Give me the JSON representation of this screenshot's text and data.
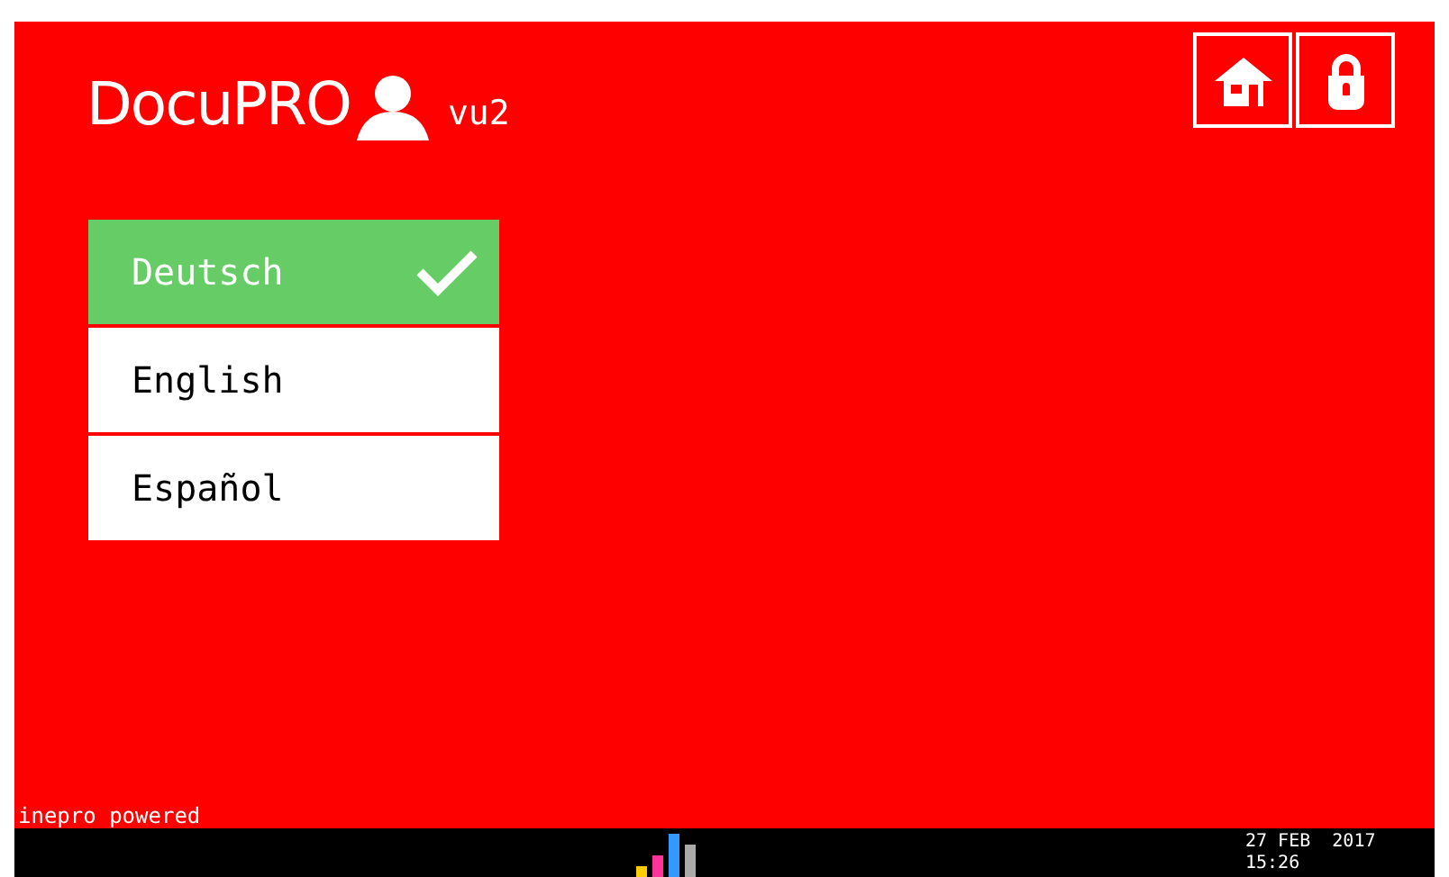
{
  "header": {
    "brand": "DocuPRO",
    "user": "vu2"
  },
  "languages": [
    {
      "label": "Deutsch",
      "selected": true
    },
    {
      "label": "English",
      "selected": false
    },
    {
      "label": "Español",
      "selected": false
    }
  ],
  "footer_note": "inepro powered",
  "status_bar": {
    "date": "27 FEB  2017",
    "time": "15:26"
  }
}
